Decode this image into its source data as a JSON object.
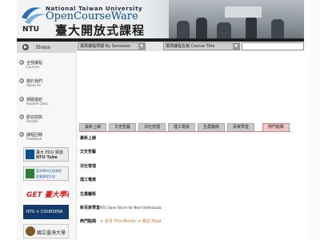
{
  "banner": {
    "university_en": "National Taiwan University",
    "brand_en": "OpenCourseWare",
    "brand_zh": "臺大開放式課程",
    "logo_text": "NTU"
  },
  "search": {
    "semester_select": "選擇課程學期 By Semester",
    "course_select": "選擇課程名稱 Course Title"
  },
  "home": {
    "label": "Home"
  },
  "sidebar": {
    "items": [
      {
        "zh": "全部課程",
        "en": "Courses"
      },
      {
        "zh": "關於我們",
        "en": "About Us"
      },
      {
        "zh": "相關連結",
        "en": "Related Links"
      },
      {
        "zh": "歡迎捐款",
        "en": "Donate"
      },
      {
        "zh": "課程回饋",
        "en": "Feedback"
      }
    ],
    "promos": [
      {
        "line1": "臺大 EDU 頻道",
        "line2": "NTU Tube"
      },
      {
        "line1": "臺灣學科先修課程",
        "line2": "推廣課程先修"
      },
      {
        "line1": "GET 臺大學程",
        "line2": ""
      },
      {
        "line1": "NTU × COURSERA",
        "line2": ""
      },
      {
        "line1": "國立臺灣大學",
        "line2": ""
      }
    ]
  },
  "tabs": [
    "最新上線",
    "文史哲藝",
    "法社管理",
    "理工電資",
    "生農醫衛",
    "百家學堂",
    "熱門點擊"
  ],
  "sections": [
    {
      "title": "最新上線",
      "text": ""
    },
    {
      "title": "文史哲藝",
      "text": ""
    },
    {
      "title": "法社管理",
      "text": ""
    },
    {
      "title": "理工電資",
      "text": ""
    },
    {
      "title": "生農醫衛",
      "text": ""
    },
    {
      "title": "新百家學堂",
      "text": "NTU Open Forum for New Intellectuals"
    }
  ],
  "hot": {
    "title": "熱門點閱",
    "month": "本月 This Month",
    "total": "累計 Total"
  },
  "colors": {
    "active_tab": "#f0c6c6",
    "link": "#d46a1a",
    "brand_blue": "#0f4c8a"
  }
}
